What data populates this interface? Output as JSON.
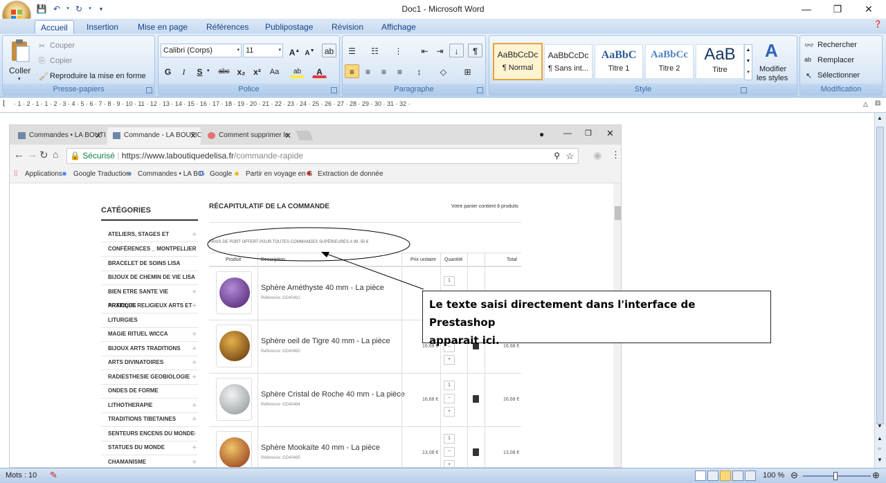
{
  "window": {
    "title": "Doc1 - Microsoft Word",
    "minimize": "—",
    "restore": "❐",
    "close": "✕"
  },
  "ribbon_tabs": [
    "Accueil",
    "Insertion",
    "Mise en page",
    "Références",
    "Publipostage",
    "Révision",
    "Affichage"
  ],
  "clipboard": {
    "paste": "Coller",
    "cut": "Couper",
    "copy": "Copier",
    "format_painter": "Reproduire la mise en forme",
    "label": "Presse-papiers"
  },
  "font": {
    "family": "Calibri (Corps)",
    "size": "11",
    "label": "Police",
    "bold": "G",
    "italic": "I",
    "underline": "S",
    "strike": "abc",
    "sub": "x₂",
    "sup": "x²",
    "case": "Aa",
    "grow": "A",
    "shrink": "A"
  },
  "paragraph": {
    "label": "Paragraphe",
    "pilcrow": "¶"
  },
  "styles": {
    "label": "Style",
    "items": [
      {
        "preview": "AaBbCcDc",
        "name": "¶ Normal"
      },
      {
        "preview": "AaBbCcDc",
        "name": "¶ Sans int..."
      },
      {
        "preview": "AaBbC",
        "name": "Titre 1"
      },
      {
        "preview": "AaBbCc",
        "name": "Titre 2"
      },
      {
        "preview": "AaB",
        "name": "Titre"
      }
    ],
    "modify": "Modifier",
    "modify2": "les styles"
  },
  "editing": {
    "label": "Modification",
    "find": "Rechercher",
    "replace": "Remplacer",
    "select": "Sélectionner"
  },
  "ruler_numbers": "· 1 · 2 · 1 · 1 · 2 · 3 · 4 · 5 · 6 · 7 · 8 · 9 · 10 · 11 · 12 · 13 · 14 · 15 · 16 · 17 · 18 · 19 · 20 · 21 · 22 · 23 · 24 · 25 · 26 · 27 · 28 · 29 · 30 · 31 · 32 ·",
  "browser": {
    "tabs": [
      "Commandes • LA BOUTI",
      "Commande - LA BOUTIC",
      "Comment supprimer le"
    ],
    "secure": "Sécurisé",
    "url_host": "https://www.laboutiquedelisa.fr",
    "url_path": "/commande-rapide",
    "bookmarks": [
      "Applications",
      "Google Traduction",
      "Commandes • LA BO",
      "Google",
      "Partir en voyage en S",
      "Extraction de donnée"
    ],
    "categories_title": "CATÉGORIES",
    "categories": [
      "ATELIERS, STAGES ET",
      "CONFÉRENCES _ MONTPELLIER",
      "BRACELET DE SOINS LISA",
      "BIJOUX DE CHEMIN DE VIE LISA",
      "BIEN ETRE SANTE VIE PRATIQUE",
      "ARTICLES RELIGIEUX ARTS ET",
      "LITURGIES",
      "MAGIE RITUEL WICCA",
      "BIJOUX ARTS TRADITIONS",
      "ARTS DIVINATOIRES",
      "RADIESTHESIE GEOBIOLOGIE",
      "ONDES DE FORME",
      "LITHOTHERAPIE",
      "TRADITIONS TIBETAINES",
      "SENTEURS ENCENS DU MONDE",
      "STATUES DU MONDE",
      "CHAMANISME"
    ],
    "recap_title": "RÉCAPITULATIF DE LA COMMANDE",
    "cart_count": "Votre panier contient 8 produits",
    "shipping_note": "FRAIS DE PORT OFFERT POUR TOUTES COMMANDES SUPÉRIEURES A 99, 50 €",
    "columns": [
      "Produit",
      "Description",
      "Prix unitaire",
      "Quantité",
      "Total"
    ],
    "products": [
      {
        "name": "Sphère Améthyste 40 mm - La pièce",
        "ref": "Référence: GD40491",
        "qty": "1",
        "price": "",
        "total": "",
        "color1": "#b28bd6",
        "color2": "#4b1f6e"
      },
      {
        "name": "Sphère oeil de Tigre 40 mm - La pièce",
        "ref": "Référence: GD40492",
        "qty": "1",
        "price": "16,68 €",
        "total": "16,68 €",
        "color1": "#e6b04a",
        "color2": "#5a2f08"
      },
      {
        "name": "Sphère Cristal de Roche 40 mm - La pièce",
        "ref": "Référence: GD40494",
        "qty": "1",
        "price": "16,68 €",
        "total": "16,68 €",
        "color1": "#f2f2f2",
        "color2": "#8a9296"
      },
      {
        "name": "Sphère Mookaïte 40 mm - La pièce",
        "ref": "Référence: GD40495",
        "qty": "1",
        "price": "13,08 €",
        "total": "13,08 €",
        "color1": "#f0c56a",
        "color2": "#8e2f12"
      }
    ]
  },
  "callout": {
    "line1": "Le texte saisi directement dans l'interface de Prestashop",
    "line2": "apparait ici."
  },
  "status": {
    "words": "Mots : 10",
    "zoom": "100 %"
  }
}
